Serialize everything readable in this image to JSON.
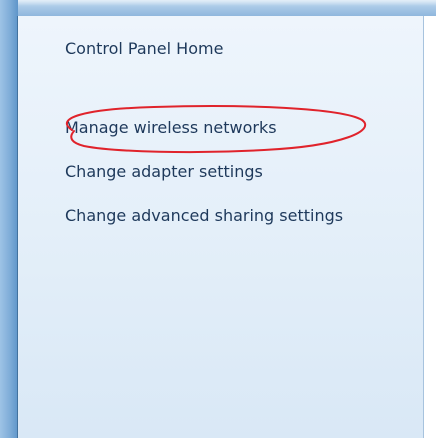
{
  "window": {
    "frame_color": "#8fb7dd"
  },
  "nav_pane": {
    "background": "#e4eff9",
    "link_color": "#1e395b",
    "links": [
      {
        "label": "Control Panel Home"
      },
      {
        "label": "Manage wireless networks",
        "annotated": true
      },
      {
        "label": "Change adapter settings"
      },
      {
        "label": "Change advanced sharing settings"
      }
    ]
  },
  "annotation": {
    "shape": "ellipse",
    "color": "#e0232b",
    "target": "Manage wireless networks"
  }
}
